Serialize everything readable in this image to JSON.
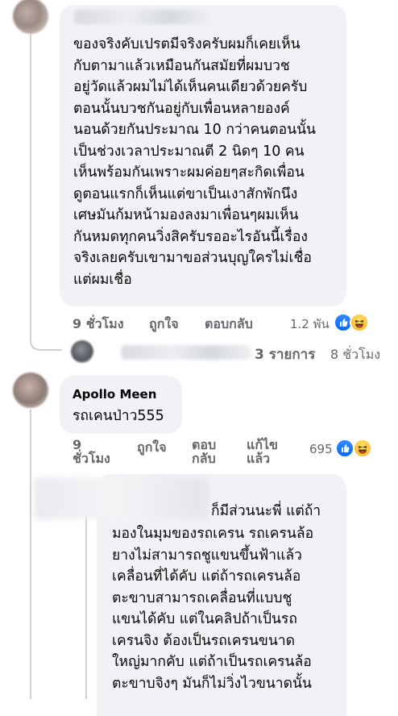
{
  "comment1": {
    "author": "",
    "text": "ของจริงคับเปรตมีจริงครับผมก็เคยเห็น\nกับตามาแล้วเหมือนกันสมัยที่ผมบวช\nอยู่วัดแล้วผมไม่ได้เห็นคนเดียวด้วยครับ\nตอนนั้นบวชกันอยู่กับเพื่อนหลายองค์\nนอนด้วยกันประมาณ 10 กว่าคนตอนนั้น\nเป็นช่วงเวลาประมาณตี 2 นิดๆ 10 คน\nเห็นพร้อมกันเพราะผมค่อยๆสะกิดเพื่อน\nดูตอนแรกก็เห็นแต่ขาเป็นเงาสักพักนึง\nเศษมันก้มหน้ามองลงมาเพื่อนๆผมเห็น\nกันหมดทุกคนวิ่งสิครับรออะไรอันนี้เรื่อง\nจริงเลยครับเขามาขอส่วนบุญใครไม่เชื่อ\nแต่ผมเชื่อ",
    "time": "9 ชั่วโมง",
    "like": "ถูกใจ",
    "reply": "ตอบกลับ",
    "reaction_count": "1.2 พัน",
    "reactions": [
      "like-icon",
      "haha-icon"
    ]
  },
  "replies_summary": {
    "count_text": "3 รายการ",
    "time": "8 ชั่วโมง"
  },
  "comment2": {
    "author": "Apollo Meen",
    "text": "รถเคนป่าว555",
    "time_line1": "9",
    "time_line2": "ชั่วโมง",
    "like": "ถูกใจ",
    "reply_line1": "ตอบ",
    "reply_line2": "กลับ",
    "edited_line1": "แก้ไข",
    "edited_line2": "แล้ว",
    "reaction_count": "695",
    "reactions": [
      "like-icon",
      "haha-icon"
    ]
  },
  "comment3": {
    "first_line": "ก็มีส่วนนะพี่ แต่ถ้า",
    "text": "มองในมุมของรถเครน รถเครนล้อ\nยางไม่สามารถชูแขนขึ้นฟ้าแล้ว\nเคลื่อนที่ได้คับ แต่ถ้ารถเครนล้อ\nตะขาบสามารถเคลื่อนที่แบบชู\nแขนได้คับ แต่ในคลิปถ้าเป็นรถ\nเครนจิง ต้องเป็นรถเครนขนาด\nใหญ่มากคับ แต่ถ้าเป็นรถเครนล้อ\nตะขาบจิงๆ มันก็ไม่วิ่งไวขนาดนั้น"
  },
  "colors": {
    "bubble": "#f0f2f5",
    "meta": "#65676b",
    "like_blue": "#0866ff",
    "haha_yellow": "#f7b125"
  }
}
